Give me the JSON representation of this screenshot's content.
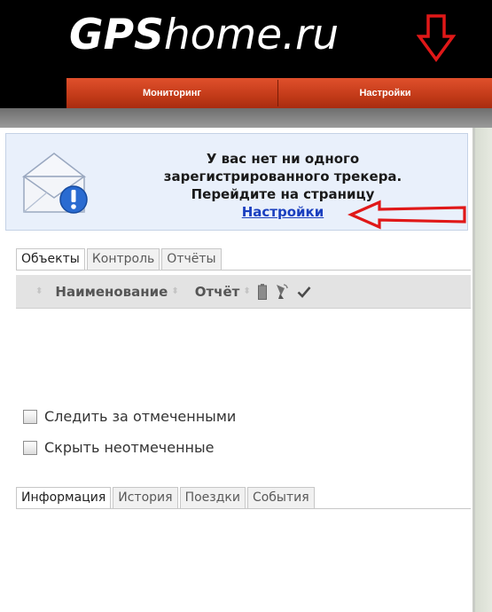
{
  "header": {
    "logo_bold": "GPS",
    "logo_light": "home.ru",
    "menu": [
      {
        "label": "Мониторинг"
      },
      {
        "label": "Настройки"
      }
    ]
  },
  "notice": {
    "lines": [
      "У вас нет ни одного",
      "зарегистрированного трекера.",
      "Перейдите на страницу"
    ],
    "link": "Настройки"
  },
  "top_tabs": [
    {
      "label": "Объекты",
      "active": true
    },
    {
      "label": "Контроль",
      "active": false
    },
    {
      "label": "Отчёты",
      "active": false
    }
  ],
  "table": {
    "columns": [
      "Наименование",
      "Отчёт"
    ],
    "icons": [
      "battery-icon",
      "satellite-icon",
      "checkmark-icon"
    ]
  },
  "options": {
    "follow_checked": "Следить за отмеченными",
    "hide_unchecked": "Скрыть неотмеченные"
  },
  "bottom_tabs": [
    {
      "label": "Информация",
      "active": true
    },
    {
      "label": "История",
      "active": false
    },
    {
      "label": "Поездки",
      "active": false
    },
    {
      "label": "События",
      "active": false
    }
  ],
  "colors": {
    "menu_red": "#c23a18",
    "link_blue": "#1a3fbf",
    "annotation_red": "#e01818",
    "notice_bg": "#e9f0fb"
  }
}
